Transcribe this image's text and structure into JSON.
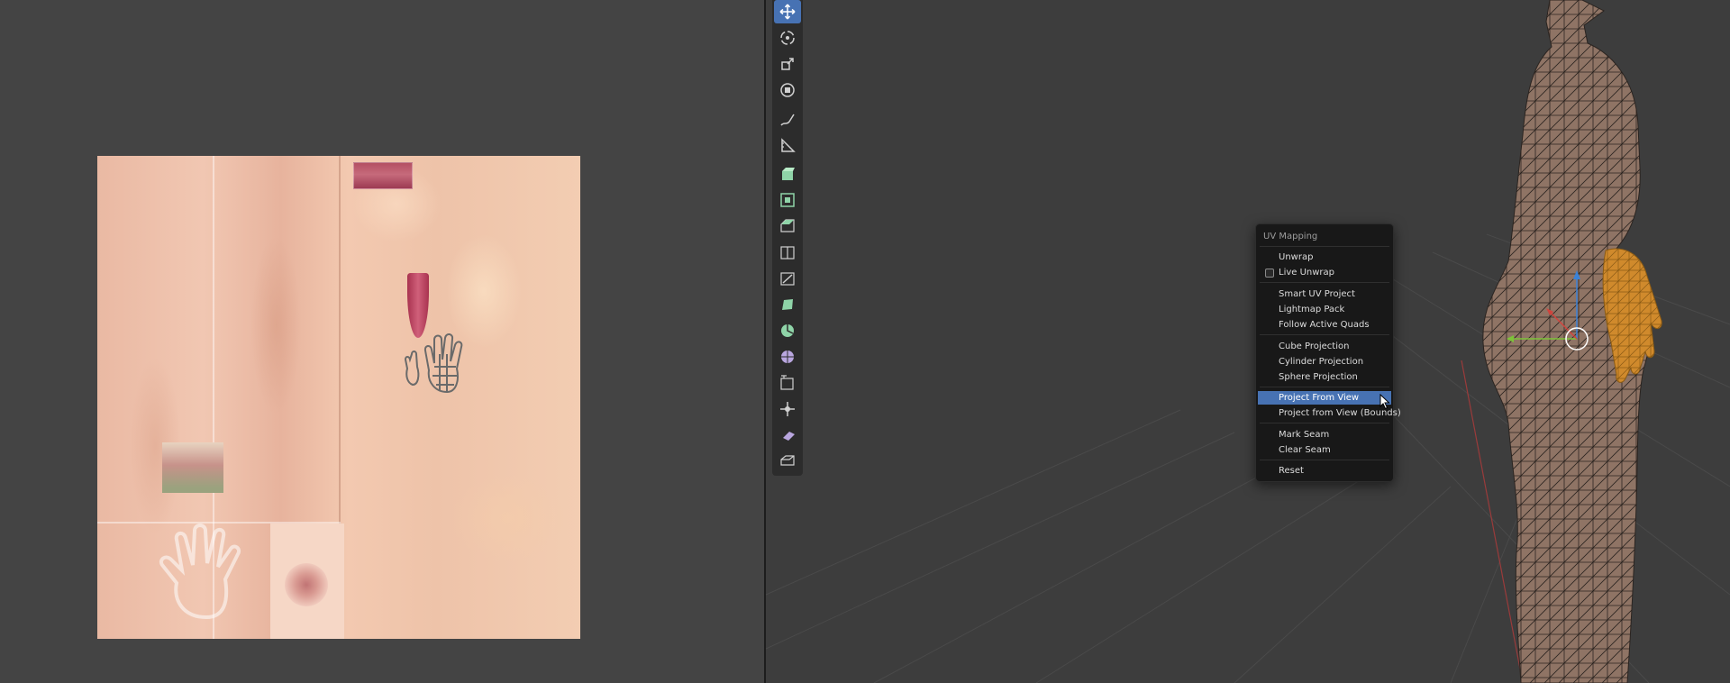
{
  "uv_menu": {
    "title": "UV Mapping",
    "items": [
      {
        "label": "Unwrap"
      },
      {
        "label": "Live Unwrap",
        "checkbox": true,
        "checked": false
      },
      {
        "label": "Smart UV Project"
      },
      {
        "label": "Lightmap Pack"
      },
      {
        "label": "Follow Active Quads"
      },
      {
        "label": "Cube Projection"
      },
      {
        "label": "Cylinder Projection"
      },
      {
        "label": "Sphere Projection"
      },
      {
        "label": "Project From View",
        "highlighted": true
      },
      {
        "label": "Project from View (Bounds)"
      },
      {
        "label": "Mark Seam"
      },
      {
        "label": "Clear Seam"
      },
      {
        "label": "Reset"
      }
    ]
  },
  "toolbar": {
    "tools": [
      {
        "icon": "move-icon",
        "active": true
      },
      {
        "icon": "rotate-icon"
      },
      {
        "icon": "scale-icon"
      },
      {
        "icon": "transform-icon"
      },
      {
        "icon": "annotate-icon"
      },
      {
        "icon": "measure-icon"
      },
      {
        "icon": "extrude-region-icon"
      },
      {
        "icon": "inset-faces-icon"
      },
      {
        "icon": "bevel-icon"
      },
      {
        "icon": "loop-cut-icon"
      },
      {
        "icon": "knife-icon"
      },
      {
        "icon": "poly-build-icon"
      },
      {
        "icon": "spin-icon"
      },
      {
        "icon": "smooth-icon"
      },
      {
        "icon": "edge-slide-icon"
      },
      {
        "icon": "shrink-fatten-icon"
      },
      {
        "icon": "shear-icon"
      },
      {
        "icon": "rip-region-icon"
      }
    ]
  },
  "colors": {
    "accent": "#4772b3",
    "menu_bg": "#181818",
    "viewport_bg": "#3d3d3d",
    "uv_editor_bg": "#444444",
    "selected_mesh": "#e8a33c",
    "axis_x": "#d0433d",
    "axis_y": "#7dc33a",
    "axis_z": "#3a82d8"
  }
}
